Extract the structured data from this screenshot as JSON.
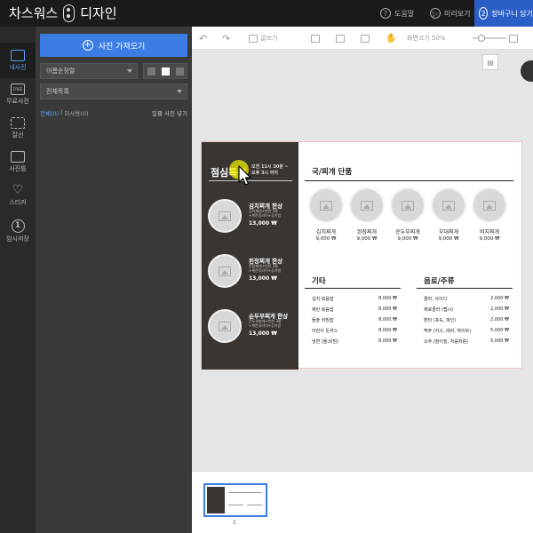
{
  "app": {
    "brand_left": "차스워스",
    "brand_right": "디자인"
  },
  "topbar": {
    "help": {
      "icon": "?",
      "label": "도움말"
    },
    "preview": {
      "icon": "▷",
      "label": "미리보기"
    },
    "cart": {
      "number": "2",
      "label": "장바구니 담기"
    }
  },
  "iconbar": {
    "items": [
      {
        "label": "내사진",
        "icon": "photo-icon"
      },
      {
        "label": "무료사진",
        "icon": "free-photo-icon",
        "badge": "FREE"
      },
      {
        "label": "칼선",
        "icon": "scissors-icon"
      },
      {
        "label": "사진틀",
        "icon": "frame-icon"
      },
      {
        "label": "스티커",
        "icon": "heart-icon"
      },
      {
        "label": "임시저장",
        "icon": "save-icon",
        "badge": "1"
      }
    ]
  },
  "panel": {
    "upload_label": "사진 가져오기",
    "sort_value": "이름순정렬",
    "list_value": "전체목록",
    "filter_all": "전체(0)",
    "filter_sep": "|",
    "filter_unused": "미사용(0)",
    "bulk_action": "일괄 사진 넣기"
  },
  "toolbar": {
    "text_label": "글쓰기",
    "zoom_label": "화면크기 50%",
    "zoom_value": 50
  },
  "design": {
    "lunch_title": "점심특선",
    "lunch_time_line1": "오전 11시 30분 ~",
    "lunch_time_line2": "오후 3시 까지",
    "specials": [
      {
        "name": "김치찌개 한상",
        "desc1": "김치찌개+반찬 3종",
        "desc2": "+계란후라이+공기밥",
        "price": "13,000 ₩"
      },
      {
        "name": "된장찌개 한상",
        "desc1": "된장찌개+반찬 3종",
        "desc2": "+계란후라이+공기밥",
        "price": "13,000 ₩"
      },
      {
        "name": "순두부찌개 한상",
        "desc1": "순두부찌개+반찬 3종",
        "desc2": "+계란후라이+공기밥",
        "price": "13,000 ₩"
      }
    ],
    "soup_title": "국/찌개 단품",
    "soups": [
      {
        "name": "김치찌개",
        "price": "9,000 ₩"
      },
      {
        "name": "된장찌개",
        "price": "9,000 ₩"
      },
      {
        "name": "순두부찌개",
        "price": "9,000 ₩"
      },
      {
        "name": "부대찌개",
        "price": "9,000 ₩"
      },
      {
        "name": "비지찌개",
        "price": "9,000 ₩"
      }
    ],
    "etc_title": "기타",
    "etc_items": [
      {
        "name": "김치 볶음밥",
        "price": "8,000 ₩"
      },
      {
        "name": "제란 볶음밥",
        "price": "8,000 ₩"
      },
      {
        "name": "돌솥 비빔밥",
        "price": "8,000 ₩"
      },
      {
        "name": "어린이 돈까스",
        "price": "8,000 ₩"
      },
      {
        "name": "냉면 (물,비빔)",
        "price": "8,000 ₩"
      }
    ],
    "drink_title": "음료/주류",
    "drink_items": [
      {
        "name": "콜라, 사이다",
        "price": "2,000 ₩"
      },
      {
        "name": "제로콜라 (펩시)",
        "price": "2,000 ₩"
      },
      {
        "name": "환타 (포도, 파인)",
        "price": "2,000 ₩"
      },
      {
        "name": "맥주 (카스, 테라, 하이트)",
        "price": "5,000 ₩"
      },
      {
        "name": "소주 (참이슬, 처음처럼)",
        "price": "5,000 ₩"
      }
    ]
  },
  "filmstrip": {
    "page_number": "1"
  },
  "colors": {
    "accent": "#3b7de3",
    "cart": "#2a5fc7",
    "menu_dark": "#3a3531"
  }
}
